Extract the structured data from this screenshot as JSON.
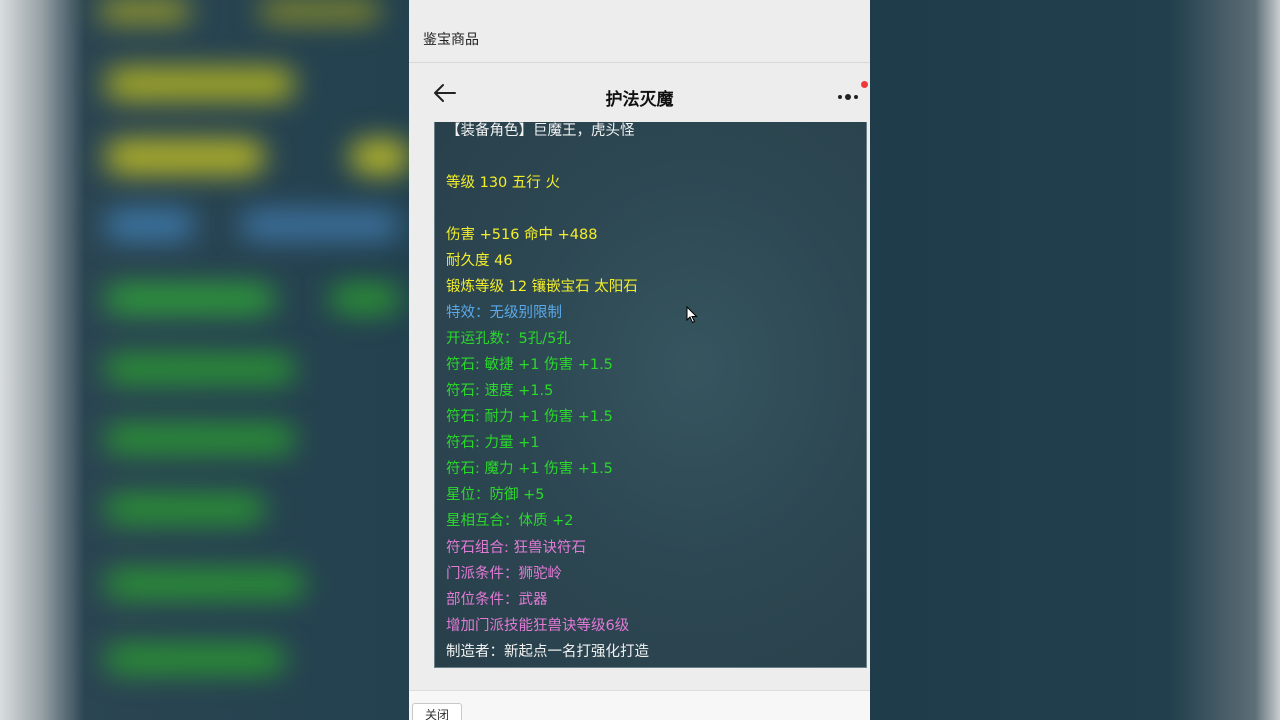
{
  "header": {
    "page_title": "鉴宝商品",
    "nav_title": "护法灭魔"
  },
  "item_details": {
    "lines": [
      {
        "text": "【装备角色】巨魔王，虎头怪",
        "color": "#f2f2f2"
      },
      {
        "text": "等级 130 五行 火",
        "color": "#f3ee2a"
      },
      {
        "text": "伤害 +516 命中 +488",
        "color": "#f3ee2a"
      },
      {
        "text": "耐久度 46",
        "color": "#f3ee2a"
      },
      {
        "text": "锻炼等级 12 镶嵌宝石 太阳石",
        "color": "#f3ee2a"
      },
      {
        "text": "特效：无级别限制",
        "color": "#5aa9e8"
      },
      {
        "text": "开运孔数：5孔/5孔",
        "color": "#2ad92a"
      },
      {
        "text": "符石: 敏捷 +1 伤害 +1.5",
        "color": "#2ad92a"
      },
      {
        "text": "符石: 速度 +1.5",
        "color": "#2ad92a"
      },
      {
        "text": "符石: 耐力 +1 伤害 +1.5",
        "color": "#2ad92a"
      },
      {
        "text": "符石: 力量 +1",
        "color": "#2ad92a"
      },
      {
        "text": "符石: 魔力 +1 伤害 +1.5",
        "color": "#2ad92a"
      },
      {
        "text": "星位：防御 +5",
        "color": "#2ad92a"
      },
      {
        "text": "星相互合：体质 +2",
        "color": "#2ad92a"
      },
      {
        "text": "符石组合: 狂兽诀符石",
        "color": "#e27ad6"
      },
      {
        "text": "门派条件：狮驼岭",
        "color": "#e27ad6"
      },
      {
        "text": "部位条件：武器",
        "color": "#e27ad6"
      },
      {
        "text": "增加门派技能狂兽诀等级6级",
        "color": "#e27ad6"
      },
      {
        "text": "制造者：新起点一名打强化打造",
        "color": "#f2f2f2"
      }
    ]
  },
  "footer": {
    "close_label": "关闭"
  },
  "colors": {
    "panel_bg": "#ededed",
    "tooltip_bg": "#2d4853",
    "notification_dot": "#f03a3a"
  },
  "icons": {
    "back": "back-arrow-icon",
    "more": "more-dots-icon",
    "cursor": "mouse-cursor-icon"
  }
}
